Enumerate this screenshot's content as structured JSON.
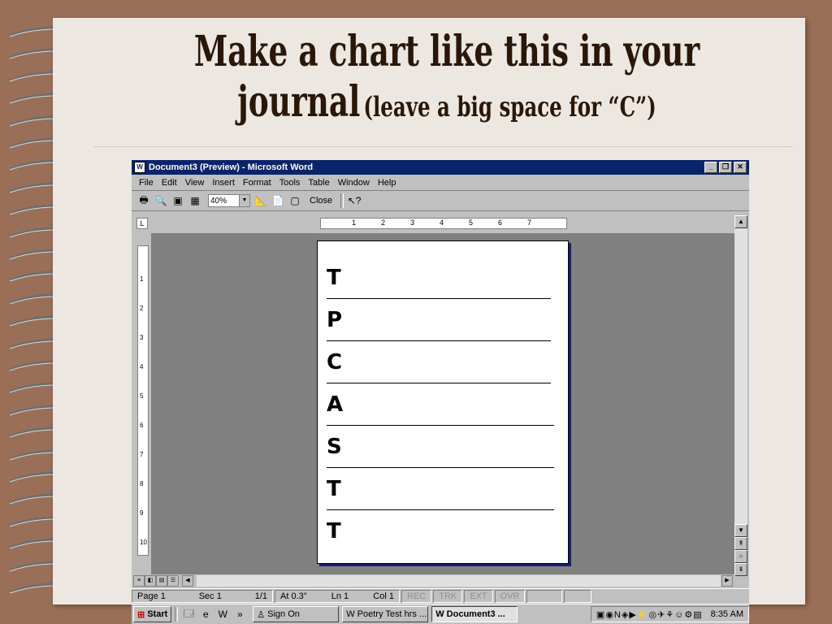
{
  "slide": {
    "title_line1": "Make a chart like this in your",
    "title_line2_big": "journal",
    "title_line2_small": "(leave a big space for “C”)"
  },
  "word": {
    "window_title": "Document3 (Preview) - Microsoft Word",
    "menu": [
      "File",
      "Edit",
      "View",
      "Insert",
      "Format",
      "Tools",
      "Table",
      "Window",
      "Help"
    ],
    "zoom": "40%",
    "close_label": "Close",
    "ruler_numbers": [
      "1",
      "2",
      "3",
      "4",
      "5",
      "6",
      "7"
    ],
    "vruler_numbers": [
      "1",
      "2",
      "3",
      "4",
      "5",
      "6",
      "7",
      "8",
      "9",
      "10"
    ],
    "page_letters": [
      "T",
      "P",
      "C",
      "A",
      "S",
      "T",
      "T"
    ],
    "status": {
      "page": "Page 1",
      "sec": "Sec 1",
      "pages": "1/1",
      "at": "At 0.3\"",
      "ln": "Ln 1",
      "col": "Col 1",
      "rec": "REC",
      "trk": "TRK",
      "ext": "EXT",
      "ovr": "OVR"
    },
    "taskbar": {
      "start": "Start",
      "items": [
        "Sign On",
        "Poetry Test hrs ...",
        "Document3 ..."
      ],
      "clock": "8:35 AM"
    }
  }
}
